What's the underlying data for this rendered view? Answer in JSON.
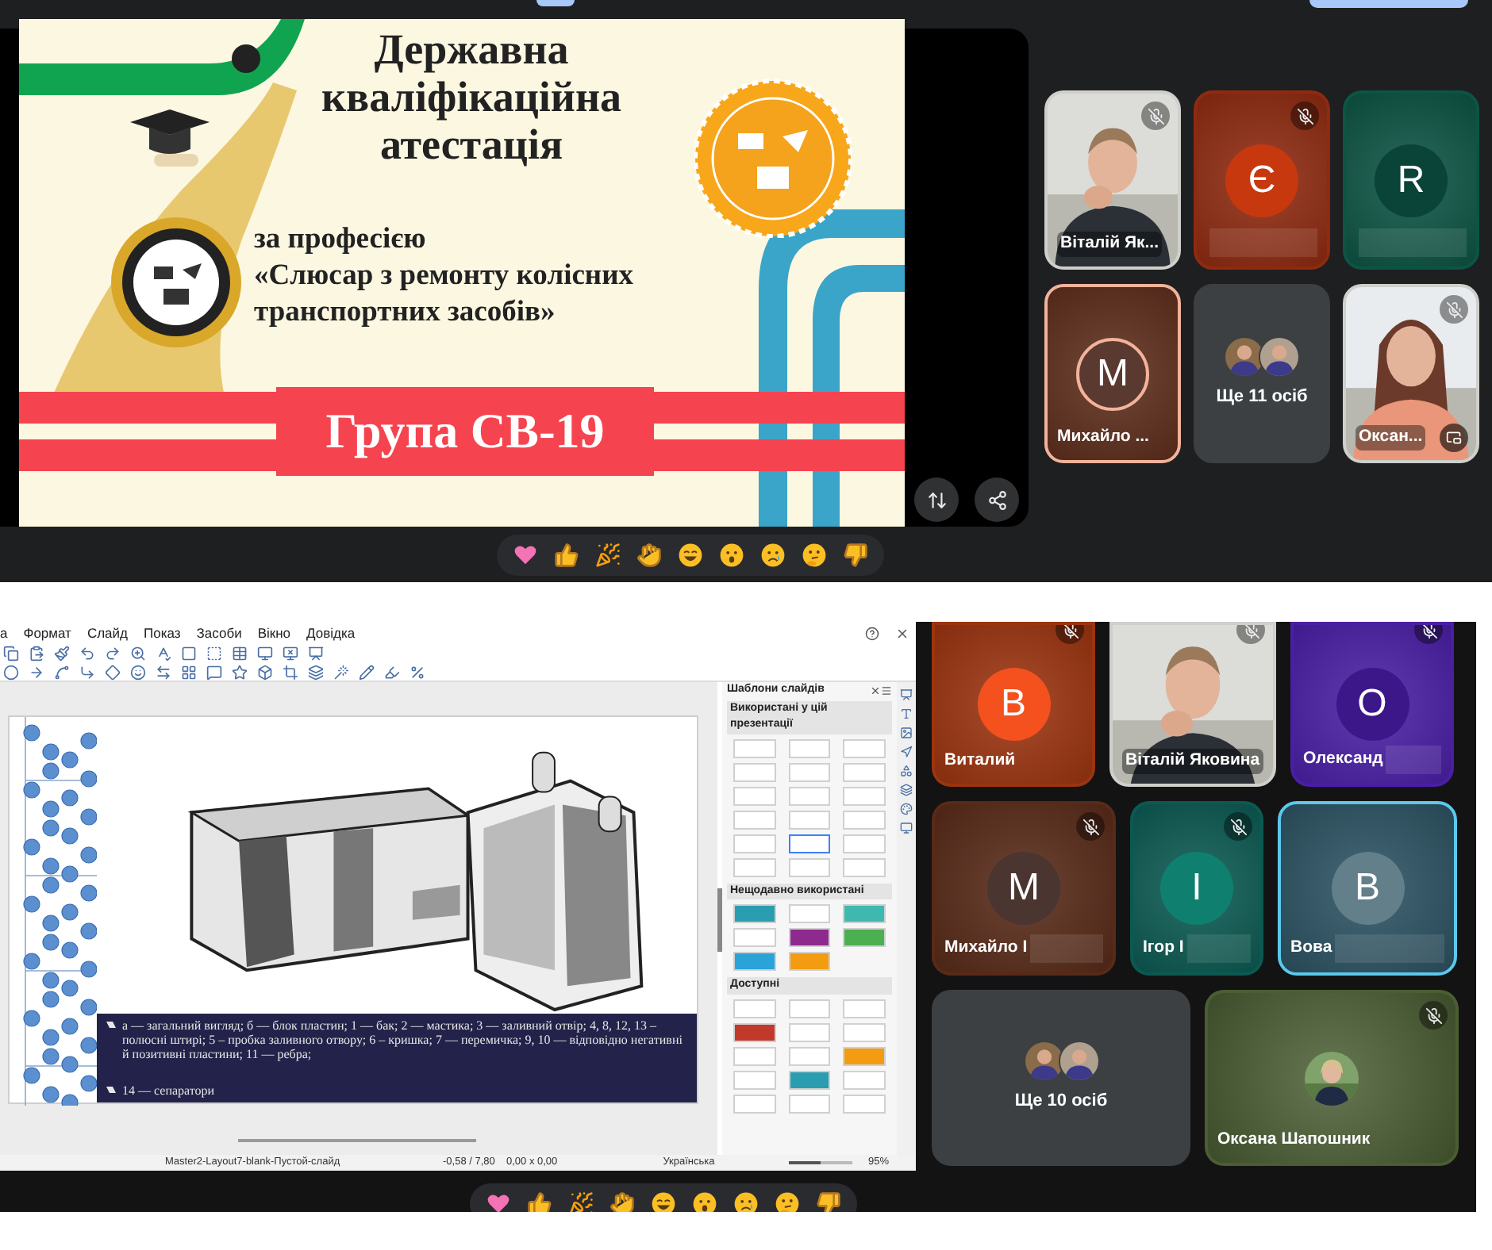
{
  "top_call": {
    "slide": {
      "title": "Державна кваліфікаційна атестація",
      "subtitle": "за професією",
      "profession": "«Слюсар з ремонту колісних транспортних засобів»",
      "banner": "Група СВ-19"
    },
    "tiles": [
      {
        "kind": "video",
        "name": "Віталій Як...",
        "muted": true,
        "speaking": false
      },
      {
        "kind": "avatar",
        "initial": "Є",
        "color": "#8f2a10",
        "avatar": {
          "color": "#c7380f"
        },
        "muted": true,
        "speaking": false,
        "redacted": true
      },
      {
        "kind": "avatar",
        "initial": "R",
        "color": "#0c5444",
        "avatar": {
          "color": "#0a4337"
        },
        "muted": false,
        "speaking": false,
        "redacted": true
      },
      {
        "kind": "avatar",
        "initial": "M",
        "name": "Михайло ...",
        "color": "#5e2e1c",
        "avatar": {
          "color": "#5a3a30"
        },
        "muted": false,
        "speaking": true
      },
      {
        "kind": "more",
        "label": "Ще 11 осіб"
      },
      {
        "kind": "video",
        "name": "Оксан...",
        "muted": true,
        "speaking": false,
        "pip": true
      }
    ]
  },
  "bottom_call": {
    "editor": {
      "menu": [
        "а",
        "Формат",
        "Слайд",
        "Показ",
        "Засоби",
        "Вікно",
        "Довідка"
      ],
      "caption": "а — загальний вигляд; б — блок пластин; 1 — бак; 2 — мастика; 3 — заливний отвір; 4, 8, 12, 13 – полюсні штирі; 5 – пробка заливного отвору; 6 – кришка; 7 — перемичка; 9, 10 — відповідно негативні й позитивні пластини; 11 — ребра;",
      "caption_2": "14 — сепаратори",
      "panel": {
        "title": "Шаблони слайдів",
        "sections": [
          {
            "title": "Використані у цій презентації",
            "thumbnails": [
              {
                "color": "#ffffff",
                "selected": false
              },
              {
                "color": "#ffffff",
                "selected": false
              },
              {
                "color": "#ffffff",
                "selected": false
              },
              {
                "color": "#ffffff",
                "selected": false
              },
              {
                "color": "#ffffff",
                "selected": false
              },
              {
                "color": "#ffffff",
                "selected": false
              },
              {
                "color": "#ffffff",
                "selected": false
              },
              {
                "color": "#ffffff",
                "selected": false
              },
              {
                "color": "#ffffff",
                "selected": false
              },
              {
                "color": "#ffffff",
                "selected": false
              },
              {
                "color": "#ffffff",
                "selected": false
              },
              {
                "color": "#ffffff",
                "selected": false
              },
              {
                "color": "#ffffff",
                "selected": false
              },
              {
                "color": "#ffffff",
                "selected": true
              },
              {
                "color": "#ffffff",
                "selected": false
              },
              {
                "color": "#ffffff",
                "selected": false
              },
              {
                "color": "#ffffff",
                "selected": false
              },
              {
                "color": "#ffffff",
                "selected": false
              }
            ]
          },
          {
            "title": "Нещодавно використані",
            "thumbnails": [
              {
                "color": "#2a9db0",
                "selected": false
              },
              {
                "color": "#ffffff",
                "selected": false
              },
              {
                "color": "#3fb8b0",
                "selected": false
              },
              {
                "color": "#ffffff",
                "selected": false
              },
              {
                "color": "#8e2a8e",
                "selected": false
              },
              {
                "color": "#4caf50",
                "selected": false
              },
              {
                "color": "#29a3d8",
                "selected": false
              },
              {
                "color": "#f39c12",
                "selected": false
              }
            ]
          },
          {
            "title": "Доступні",
            "thumbnails": [
              {
                "color": "#ffffff",
                "selected": false
              },
              {
                "color": "#ffffff",
                "selected": false
              },
              {
                "color": "#ffffff",
                "selected": false
              },
              {
                "color": "#c0392b",
                "selected": false
              },
              {
                "color": "#ffffff",
                "selected": false
              },
              {
                "color": "#ffffff",
                "selected": false
              },
              {
                "color": "#ffffff",
                "selected": false
              },
              {
                "color": "#ffffff",
                "selected": false
              },
              {
                "color": "#f39c12",
                "selected": false
              },
              {
                "color": "#ffffff",
                "selected": false
              },
              {
                "color": "#2a9db0",
                "selected": false
              },
              {
                "color": "#ffffff",
                "selected": false
              },
              {
                "color": "#ffffff",
                "selected": false
              },
              {
                "color": "#ffffff",
                "selected": false
              },
              {
                "color": "#ffffff",
                "selected": false
              }
            ]
          }
        ]
      },
      "status": {
        "layout": "Master2-Layout7-blank-Пустой-слайд",
        "position": "-0,58 / 7,80",
        "size": "0,00 x 0,00",
        "language": "Українська",
        "zoom": "95%",
        "zoom_slider": {
          "level": 0.5
        }
      }
    },
    "rows": [
      [
        {
          "kind": "avatar",
          "initial": "В",
          "name": "Виталий",
          "color": "#9c3410",
          "avatar": {
            "color": "#f4511e"
          },
          "muted": true,
          "speaking": false
        },
        {
          "kind": "video",
          "name": "Віталій Яковина",
          "muted": true,
          "speaking": false
        },
        {
          "kind": "avatar",
          "initial": "О",
          "name": "Олександ",
          "color": "#4a1fa6",
          "avatar": {
            "color": "#3b178a"
          },
          "muted": true,
          "speaking": false,
          "redacted": true
        }
      ],
      [
        {
          "kind": "avatar",
          "initial": "М",
          "name": "Михайло І",
          "color": "#582a18",
          "avatar": {
            "color": "#4b3530"
          },
          "muted": true,
          "speaking": false,
          "redacted": true
        },
        {
          "kind": "avatar",
          "initial": "І",
          "name": "Ігор І",
          "color": "#0b5a52",
          "avatar": {
            "color": "#0f8070"
          },
          "muted": true,
          "speaking": false,
          "redacted": true
        },
        {
          "kind": "avatar",
          "initial": "В",
          "name": "Вова",
          "color": "#2c5262",
          "avatar": {
            "color": "#627f8a"
          },
          "muted": false,
          "speaking": true,
          "redacted": true
        }
      ],
      [
        {
          "kind": "more",
          "label": "Ще 10 осіб"
        },
        {
          "kind": "photo_avatar",
          "name": "Оксана Шапошник",
          "color": "#4b5e33",
          "muted": true,
          "speaking": false
        }
      ]
    ]
  }
}
